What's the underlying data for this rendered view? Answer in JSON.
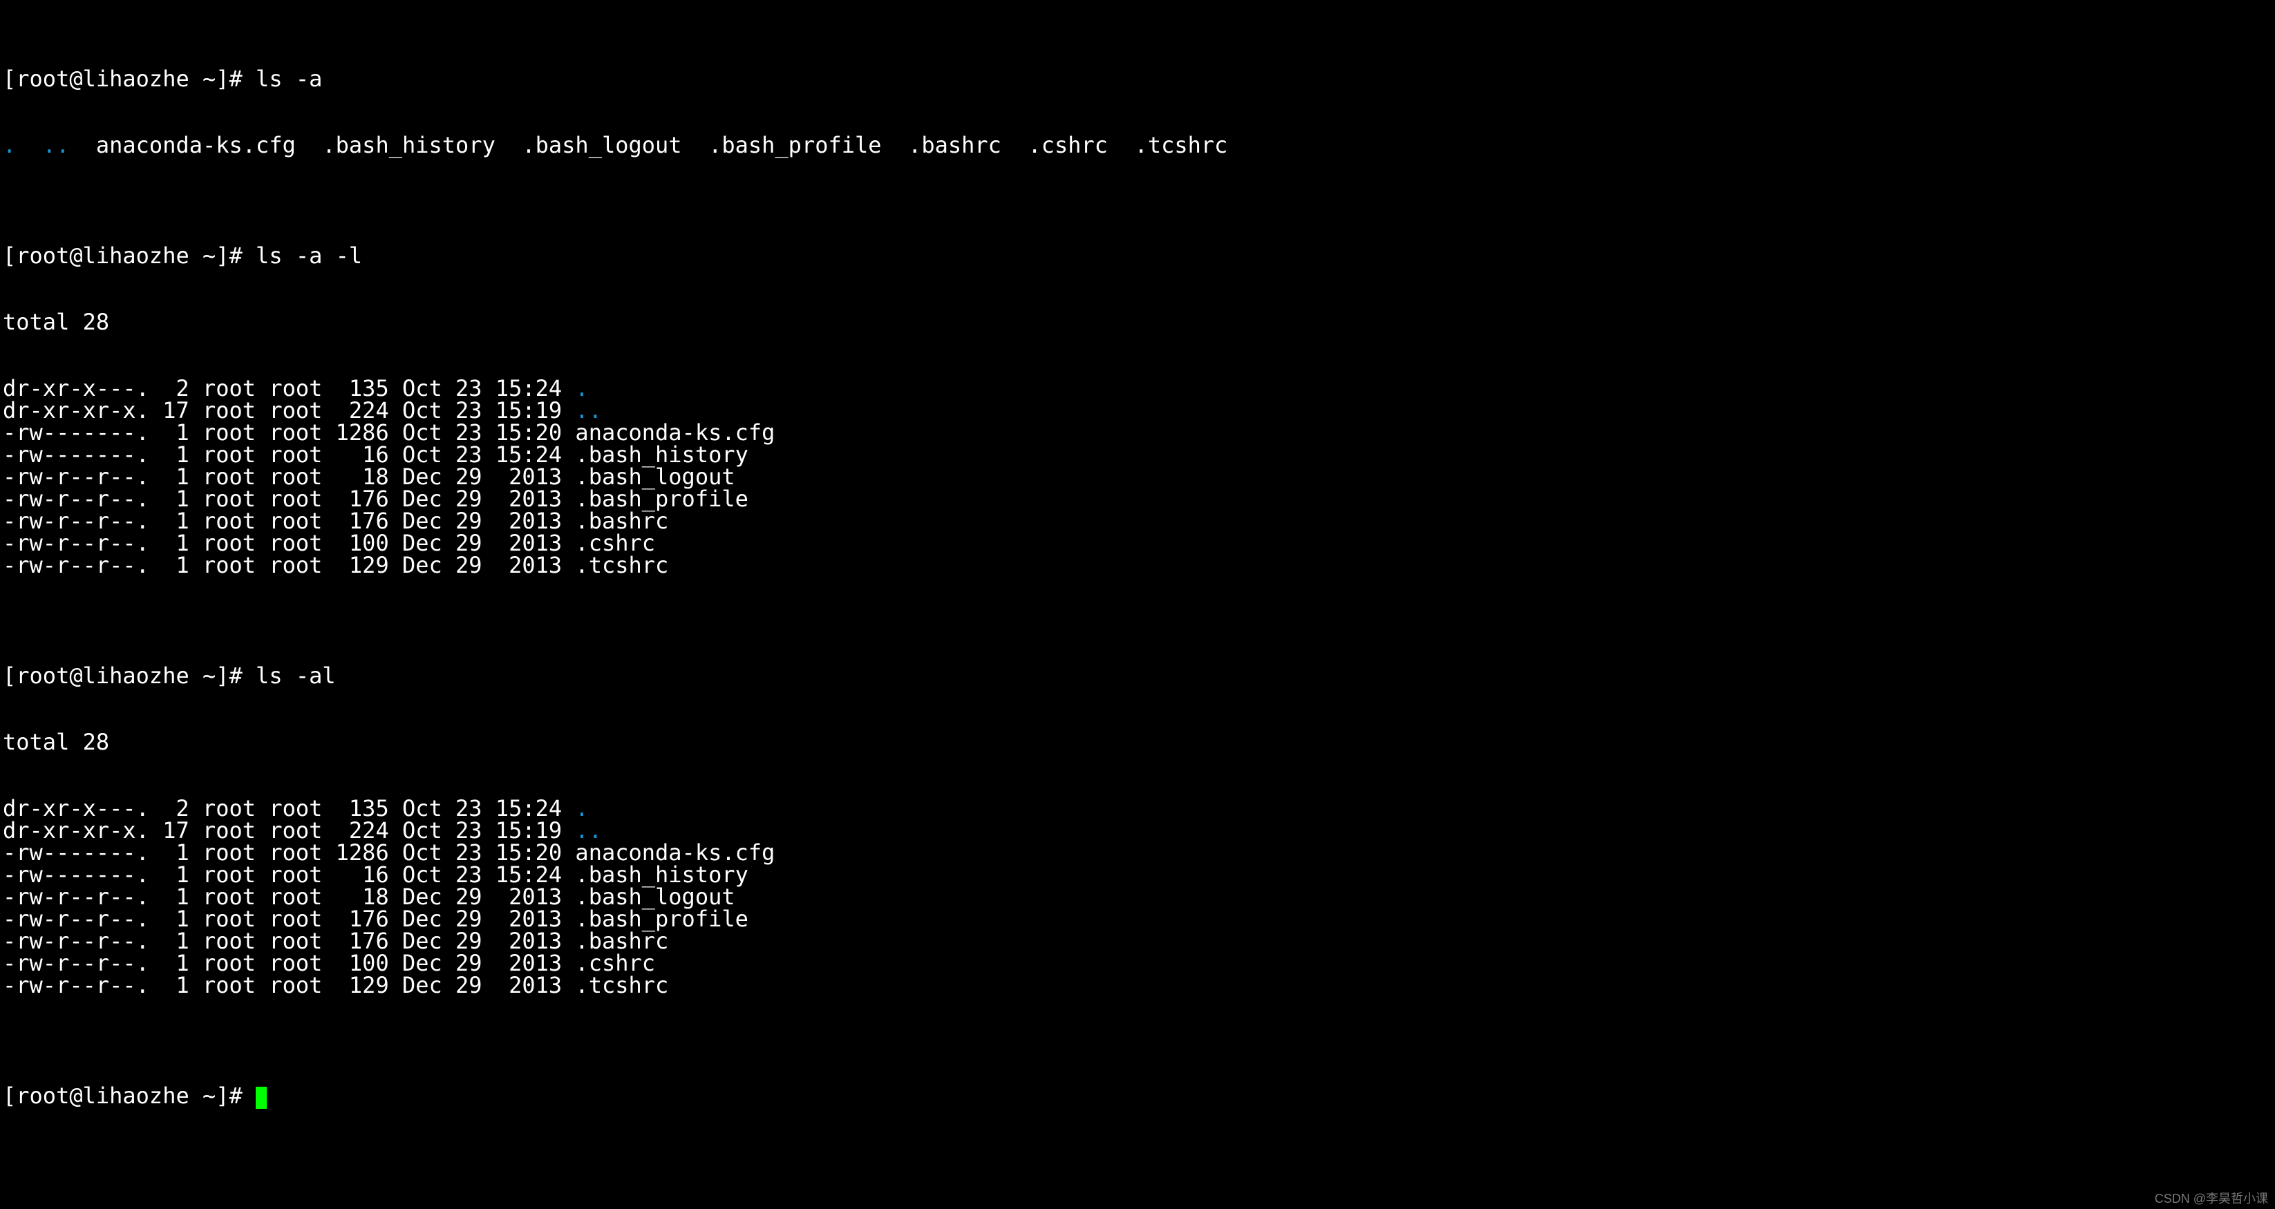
{
  "prompt": "[root@lihaozhe ~]# ",
  "cmd1": "ls -a",
  "cmd2": "ls -a -l",
  "cmd3": "ls -al",
  "ls_a": {
    "dot": ".",
    "dotdot": "..",
    "rest": "  anaconda-ks.cfg  .bash_history  .bash_logout  .bash_profile  .bashrc  .cshrc  .tcshrc"
  },
  "total": "total 28",
  "listing": [
    {
      "perm": "dr-xr-x---.  2 root root  135 Oct 23 15:24 ",
      "name": ".",
      "dir": true
    },
    {
      "perm": "dr-xr-xr-x. 17 root root  224 Oct 23 15:19 ",
      "name": "..",
      "dir": true
    },
    {
      "perm": "-rw-------.  1 root root 1286 Oct 23 15:20 ",
      "name": "anaconda-ks.cfg",
      "dir": false
    },
    {
      "perm": "-rw-------.  1 root root   16 Oct 23 15:24 ",
      "name": ".bash_history",
      "dir": false
    },
    {
      "perm": "-rw-r--r--.  1 root root   18 Dec 29  2013 ",
      "name": ".bash_logout",
      "dir": false
    },
    {
      "perm": "-rw-r--r--.  1 root root  176 Dec 29  2013 ",
      "name": ".bash_profile",
      "dir": false
    },
    {
      "perm": "-rw-r--r--.  1 root root  176 Dec 29  2013 ",
      "name": ".bashrc",
      "dir": false
    },
    {
      "perm": "-rw-r--r--.  1 root root  100 Dec 29  2013 ",
      "name": ".cshrc",
      "dir": false
    },
    {
      "perm": "-rw-r--r--.  1 root root  129 Dec 29  2013 ",
      "name": ".tcshrc",
      "dir": false
    }
  ],
  "watermark": "CSDN @李昊哲小课"
}
